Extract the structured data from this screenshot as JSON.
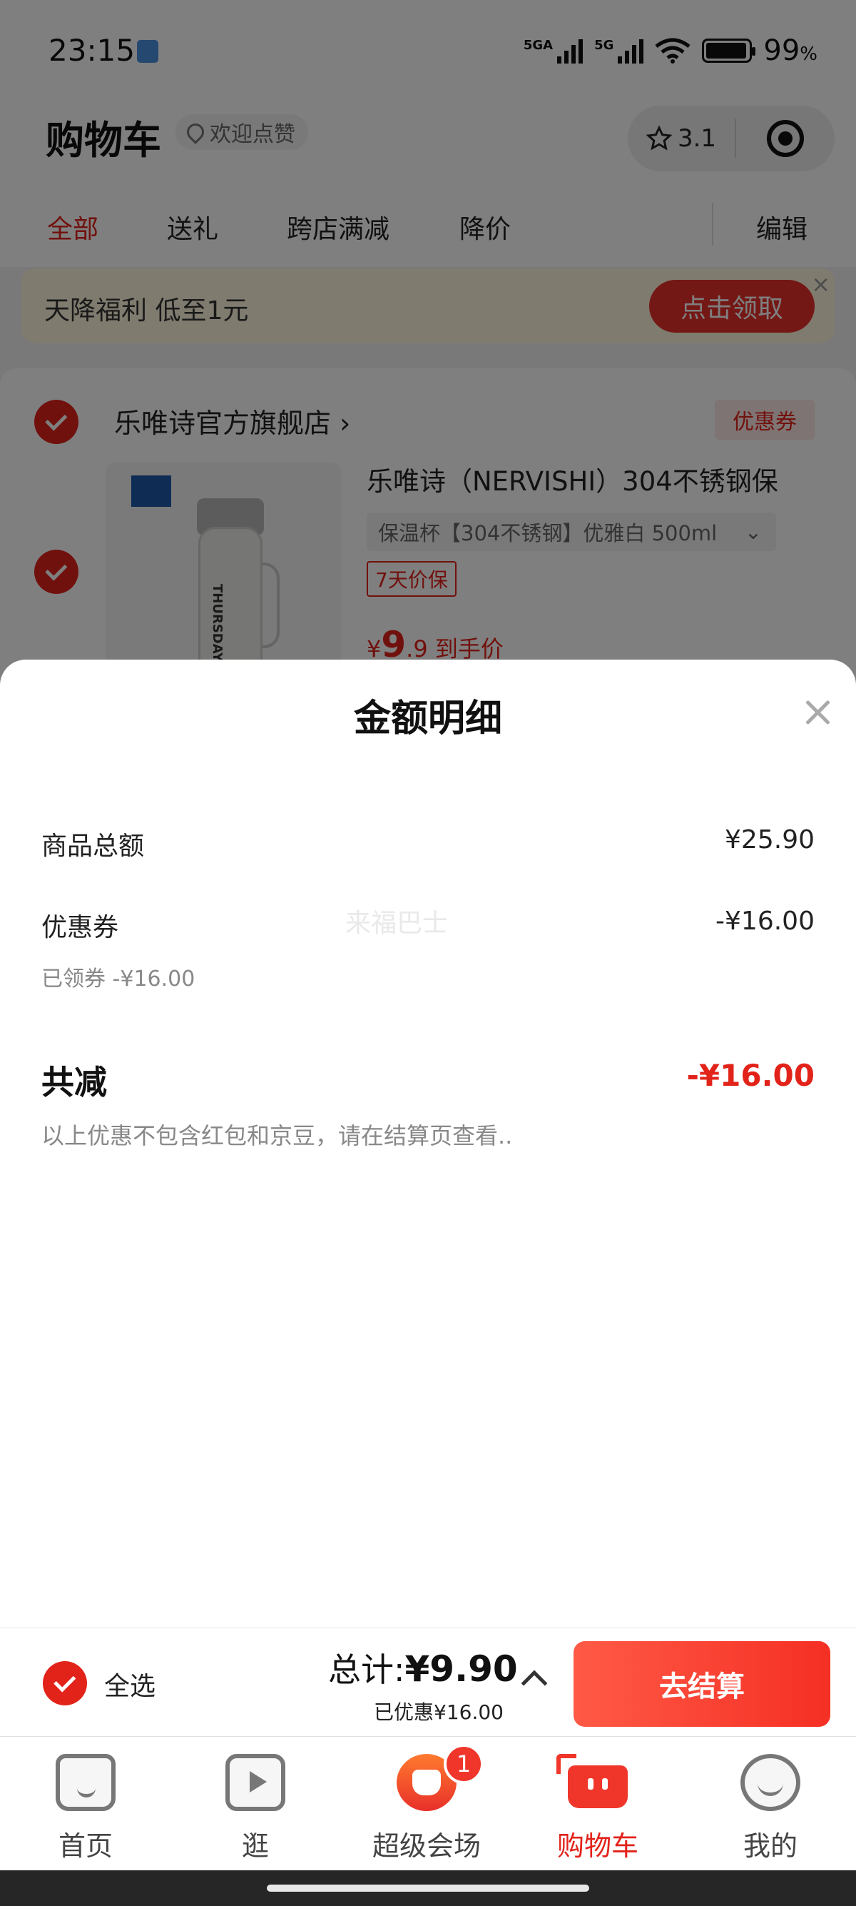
{
  "status_bar": {
    "time": "23:15",
    "network_1": "5GA",
    "network_2": "5G",
    "battery": "99",
    "battery_unit": "%"
  },
  "header": {
    "title": "购物车",
    "chip_label": "欢迎点赞",
    "rating": "3.1"
  },
  "tabs": [
    {
      "label": "全部",
      "active": true
    },
    {
      "label": "送礼",
      "active": false
    },
    {
      "label": "跨店满减",
      "active": false
    },
    {
      "label": "降价",
      "active": false
    }
  ],
  "edit_label": "编辑",
  "banner": {
    "text": "天降福利 低至1元",
    "button": "点击领取"
  },
  "store": {
    "name": "乐唯诗官方旗舰店",
    "coupon_tag": "优惠券",
    "product": {
      "title": "乐唯诗（NERVISHI）304不锈钢保",
      "spec": "保温杯【304不锈钢】优雅白 500ml",
      "guarantee": "7天价保",
      "price_symbol": "¥",
      "price_int": "9",
      "price_dec": ".9",
      "price_note": "到手价",
      "bottle_text": "THURSDAY"
    }
  },
  "sheet": {
    "title": "金额明细",
    "rows": [
      {
        "label": "商品总额",
        "value": "¥25.90"
      },
      {
        "label": "优惠券",
        "value": "-¥16.00",
        "sub": "已领券 -¥16.00"
      }
    ],
    "total_label": "共减",
    "total_value": "-¥16.00",
    "note": "以上优惠不包含红包和京豆，请在结算页查看..",
    "watermark": "来福巴士"
  },
  "checkout": {
    "select_all": "全选",
    "total_prefix": "总计:",
    "total_value": "¥9.90",
    "saved": "已优惠¥16.00",
    "button": "去结算"
  },
  "tabbar": [
    {
      "label": "首页",
      "icon": "home-icon"
    },
    {
      "label": "逛",
      "icon": "play-icon"
    },
    {
      "label": "超级会场",
      "icon": "venue-icon",
      "badge": "1"
    },
    {
      "label": "购物车",
      "icon": "cart-icon",
      "active": true
    },
    {
      "label": "我的",
      "icon": "profile-icon"
    }
  ],
  "colors": {
    "accent": "#e2231a",
    "button": "#f52f24",
    "banner_bg": "#fff6df"
  }
}
